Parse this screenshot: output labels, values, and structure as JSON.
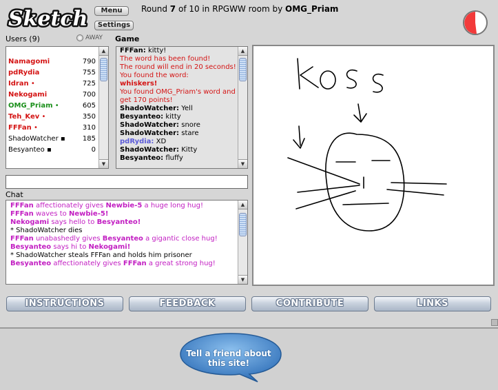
{
  "app": {
    "logo_text": "Sketch"
  },
  "header": {
    "menu_label": "Menu",
    "settings_label": "Settings",
    "round_prefix": "Round ",
    "round_current": "7",
    "round_middle": " of 10 in RPGWW room by ",
    "room_owner": "OMG_Priam"
  },
  "users": {
    "label": "Users (9)",
    "away_label": "AWAY",
    "list": [
      {
        "name": "Namagomi",
        "marker": "",
        "score": "790",
        "color": "#d41414",
        "bold": true
      },
      {
        "name": "pdRydia",
        "marker": "",
        "score": "755",
        "color": "#d41414",
        "bold": true
      },
      {
        "name": "Idran",
        "marker": " •",
        "score": "725",
        "color": "#d41414",
        "bold": true
      },
      {
        "name": "Nekogami",
        "marker": "",
        "score": "700",
        "color": "#d41414",
        "bold": true
      },
      {
        "name": "OMG_Priam",
        "marker": " •",
        "score": "605",
        "color": "#1a8f1a",
        "bold": true
      },
      {
        "name": "Teh_Kev",
        "marker": " •",
        "score": "350",
        "color": "#d41414",
        "bold": true
      },
      {
        "name": "FFFan",
        "marker": " •",
        "score": "310",
        "color": "#d41414",
        "bold": true
      },
      {
        "name": "ShadoWatcher",
        "marker": " ▪",
        "score": "185",
        "color": "#000000",
        "bold": false
      },
      {
        "name": "Besyanteo",
        "marker": " ▪",
        "score": "0",
        "color": "#000000",
        "bold": false
      }
    ]
  },
  "game": {
    "label": "Game",
    "messages": [
      {
        "nick": "FFFan:",
        "text": " kitty!"
      },
      {
        "nick": "",
        "text": "The word has been found!",
        "cls": "red"
      },
      {
        "nick": "",
        "text": "The round will end in 20 seconds!",
        "cls": "red"
      },
      {
        "nick": "",
        "text": "You found the word:",
        "cls": "red"
      },
      {
        "nick": "",
        "text": "whiskers!",
        "cls": "red nick"
      },
      {
        "nick": "",
        "text": "You found OMG_Priam's word and get 170 points!",
        "cls": "red"
      },
      {
        "nick": "ShadoWatcher:",
        "text": " Yell"
      },
      {
        "nick": "Besyanteo:",
        "text": " kitty"
      },
      {
        "nick": "ShadoWatcher:",
        "text": " snore"
      },
      {
        "nick": "ShadoWatcher:",
        "text": " stare"
      },
      {
        "nick": "pdRydia:",
        "text": " XD",
        "nick_color": "#5b5bd8"
      },
      {
        "nick": "ShadoWatcher:",
        "text": " Kitty"
      },
      {
        "nick": "Besyanteo:",
        "text": " fluffy"
      }
    ]
  },
  "chat": {
    "label": "Chat",
    "input_value": "",
    "messages": [
      {
        "parts": [
          [
            "FFFan",
            "n"
          ],
          [
            " affectionately gives ",
            "t"
          ],
          [
            "Newbie-5",
            "n"
          ],
          [
            " a huge long hug!",
            "t"
          ]
        ],
        "magenta": true
      },
      {
        "parts": [
          [
            "FFFan",
            "n"
          ],
          [
            " waves to ",
            "t"
          ],
          [
            "Newbie-5!",
            "n"
          ]
        ],
        "magenta": true
      },
      {
        "parts": [
          [
            "Nekogami",
            "n"
          ],
          [
            " says hello to ",
            "t"
          ],
          [
            "Besyanteo!",
            "n"
          ]
        ],
        "magenta": true
      },
      {
        "parts": [
          [
            "* ShadoWatcher dies",
            "t"
          ]
        ],
        "magenta": false
      },
      {
        "parts": [
          [
            "FFFan",
            "n"
          ],
          [
            " unabashedly gives ",
            "t"
          ],
          [
            "Besyanteo",
            "n"
          ],
          [
            " a gigantic close hug!",
            "t"
          ]
        ],
        "magenta": true
      },
      {
        "parts": [
          [
            "Besyanteo",
            "n"
          ],
          [
            " says hi to ",
            "t"
          ],
          [
            "Nekogami!",
            "n"
          ]
        ],
        "magenta": true
      },
      {
        "parts": [
          [
            "* ShadoWatcher steals FFFan and holds him prisoner",
            "t"
          ]
        ],
        "magenta": false
      },
      {
        "parts": [
          [
            "Besyanteo",
            "n"
          ],
          [
            " affectionately gives ",
            "t"
          ],
          [
            "FFFan",
            "n"
          ],
          [
            " a great strong hug!",
            "t"
          ]
        ],
        "magenta": true
      }
    ]
  },
  "canvas": {
    "drawn_text": "KOSS"
  },
  "nav": {
    "instructions": "INSTRUCTIONS",
    "feedback": "FEEDBACK",
    "contribute": "CONTRIBUTE",
    "links": "LINKS"
  },
  "footer": {
    "tell_friend": "Tell a friend about this site!"
  },
  "colors": {
    "red": "#d41414",
    "green": "#1a8f1a",
    "magenta": "#c21ec2",
    "timer_red": "#f23a3a",
    "bubble": "#3f7fc4"
  }
}
